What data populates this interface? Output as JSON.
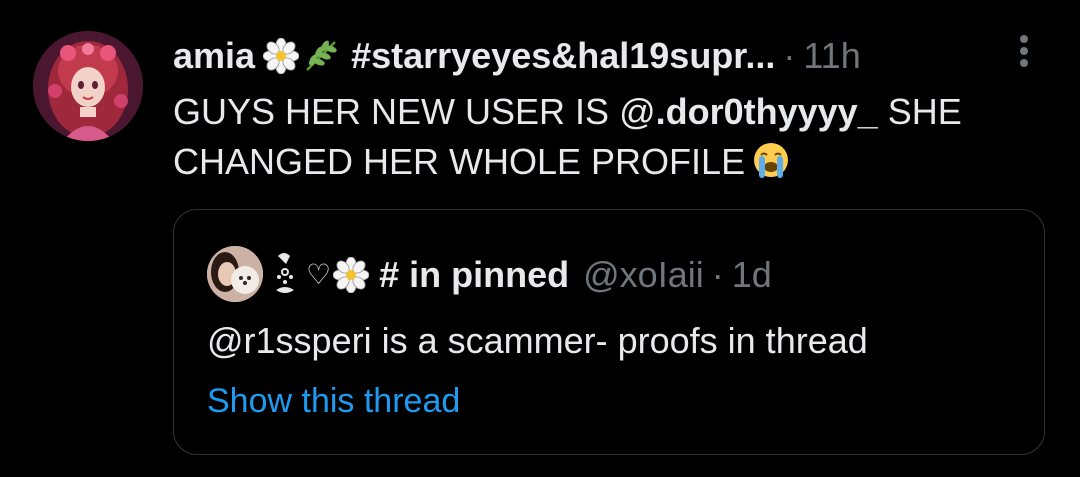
{
  "tweet": {
    "display_name": "amia",
    "hashtag_name": "#starryeyes&hal19supr...",
    "separator": "·",
    "time": "11h",
    "text_before": "GUYS HER NEW USER IS @",
    "mention": ".dor0thyyyy_",
    "text_after": " SHE CHANGED HER WHOLE PROFILE",
    "icons": [
      "blossom-icon",
      "herb-icon",
      "crying-face-icon",
      "more-icon"
    ]
  },
  "quote": {
    "display_heart": "♡",
    "display_name": "# in pinned",
    "handle": "@xoIaii",
    "separator": "·",
    "time": "1d",
    "text": "@r1ssperi is a scammer- proofs in thread",
    "show_thread": "Show this thread",
    "icons": [
      "bow-decoration-icon",
      "blossom-icon"
    ]
  },
  "colors": {
    "background": "#000000",
    "text": "#e7e9ea",
    "muted": "#71767b",
    "link": "#1d9bf0",
    "border": "#2f3336"
  }
}
